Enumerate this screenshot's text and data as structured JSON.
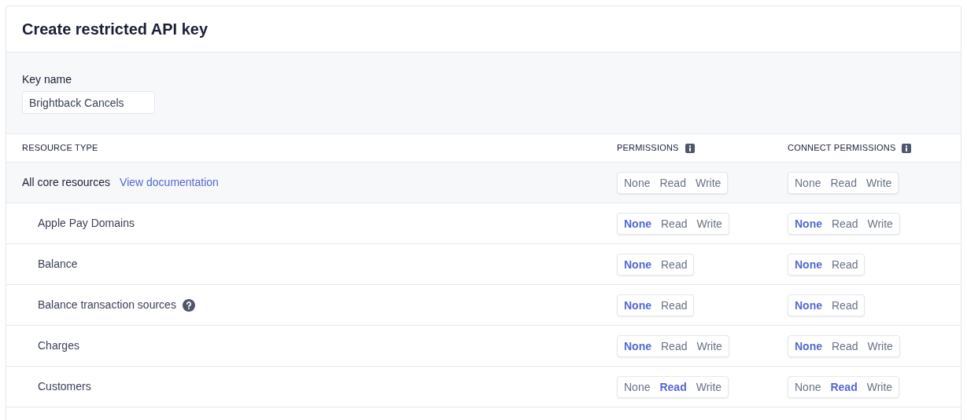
{
  "title": "Create restricted API key",
  "key_name": {
    "label": "Key name",
    "value": "Brightback Cancels"
  },
  "columns": [
    {
      "label": "RESOURCE TYPE",
      "info": false
    },
    {
      "label": "PERMISSIONS",
      "info": true
    },
    {
      "label": "CONNECT PERMISSIONS",
      "info": true
    }
  ],
  "group": {
    "label": "All core resources",
    "link": "View documentation",
    "permissions": [
      {
        "label": "None",
        "selected": false
      },
      {
        "label": "Read",
        "selected": false
      },
      {
        "label": "Write",
        "selected": false
      }
    ],
    "connect_permissions": [
      {
        "label": "None",
        "selected": false
      },
      {
        "label": "Read",
        "selected": false
      },
      {
        "label": "Write",
        "selected": false
      }
    ],
    "children": [
      {
        "label": "Apple Pay Domains",
        "help": false,
        "permissions": [
          {
            "label": "None",
            "selected": true
          },
          {
            "label": "Read",
            "selected": false
          },
          {
            "label": "Write",
            "selected": false
          }
        ],
        "connect_permissions": [
          {
            "label": "None",
            "selected": true
          },
          {
            "label": "Read",
            "selected": false
          },
          {
            "label": "Write",
            "selected": false
          }
        ]
      },
      {
        "label": "Balance",
        "help": false,
        "permissions": [
          {
            "label": "None",
            "selected": true
          },
          {
            "label": "Read",
            "selected": false
          }
        ],
        "connect_permissions": [
          {
            "label": "None",
            "selected": true
          },
          {
            "label": "Read",
            "selected": false
          }
        ]
      },
      {
        "label": "Balance transaction sources",
        "help": true,
        "permissions": [
          {
            "label": "None",
            "selected": true
          },
          {
            "label": "Read",
            "selected": false
          }
        ],
        "connect_permissions": [
          {
            "label": "None",
            "selected": true
          },
          {
            "label": "Read",
            "selected": false
          }
        ]
      },
      {
        "label": "Charges",
        "help": false,
        "permissions": [
          {
            "label": "None",
            "selected": true
          },
          {
            "label": "Read",
            "selected": false
          },
          {
            "label": "Write",
            "selected": false
          }
        ],
        "connect_permissions": [
          {
            "label": "None",
            "selected": true
          },
          {
            "label": "Read",
            "selected": false
          },
          {
            "label": "Write",
            "selected": false
          }
        ]
      },
      {
        "label": "Customers",
        "help": false,
        "permissions": [
          {
            "label": "None",
            "selected": false
          },
          {
            "label": "Read",
            "selected": true
          },
          {
            "label": "Write",
            "selected": false
          }
        ],
        "connect_permissions": [
          {
            "label": "None",
            "selected": false
          },
          {
            "label": "Read",
            "selected": true
          },
          {
            "label": "Write",
            "selected": false
          }
        ]
      }
    ]
  }
}
